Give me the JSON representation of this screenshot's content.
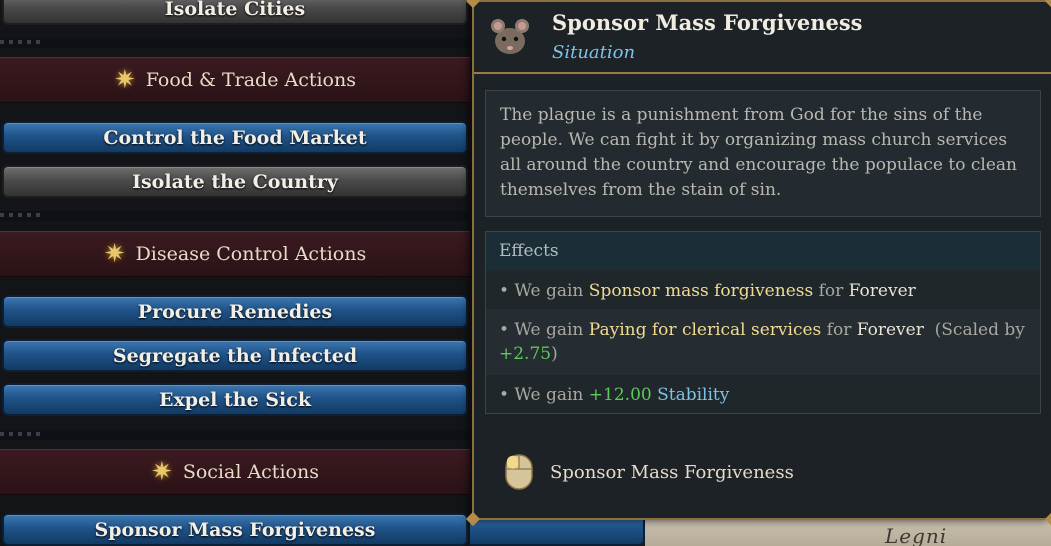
{
  "left_panel": {
    "partial_top_button": "Isolate Cities",
    "categories": [
      {
        "label": "Food & Trade Actions"
      },
      {
        "label": "Disease Control Actions"
      },
      {
        "label": "Social Actions"
      }
    ],
    "buttons": [
      {
        "label": "Control the Food Market",
        "style": "blue"
      },
      {
        "label": "Isolate the Country",
        "style": "gray"
      },
      {
        "label": "Procure Remedies",
        "style": "blue"
      },
      {
        "label": "Segregate the Infected",
        "style": "blue"
      },
      {
        "label": "Expel the Sick",
        "style": "blue"
      },
      {
        "label": "Sponsor Mass Forgiveness",
        "style": "blue"
      }
    ]
  },
  "map": {
    "label": "Legni"
  },
  "tooltip": {
    "title": "Sponsor Mass Forgiveness",
    "subtitle": "Situation",
    "icon": "rat-icon",
    "description": "The plague is a punishment from God for the sins of the people. We can fight it by organizing mass church services all around the country and encourage the populace to clean themselves from the stain of sin.",
    "effects_header": "Effects",
    "effects": [
      {
        "prefix": "• We gain ",
        "modifier": "Sponsor mass forgiveness",
        "for_text": " for ",
        "duration": "Forever"
      },
      {
        "prefix": "• We gain ",
        "modifier": "Paying for clerical services",
        "for_text": " for ",
        "duration": "Forever",
        "scaled_prefix": "(Scaled by",
        "scaled_value": "+2.75",
        "scaled_suffix": ")"
      },
      {
        "prefix": "• We gain ",
        "value": "+12.00",
        "stat": "Stability"
      }
    ],
    "footer_icon": "mouse-icon",
    "footer_label": "Sponsor Mass Forgiveness"
  },
  "colors": {
    "highlight_yellow": "#f0dc93",
    "positive_green": "#5ec85a",
    "link_blue": "#7cc3e6",
    "gold_border": "#8a6f3f"
  }
}
